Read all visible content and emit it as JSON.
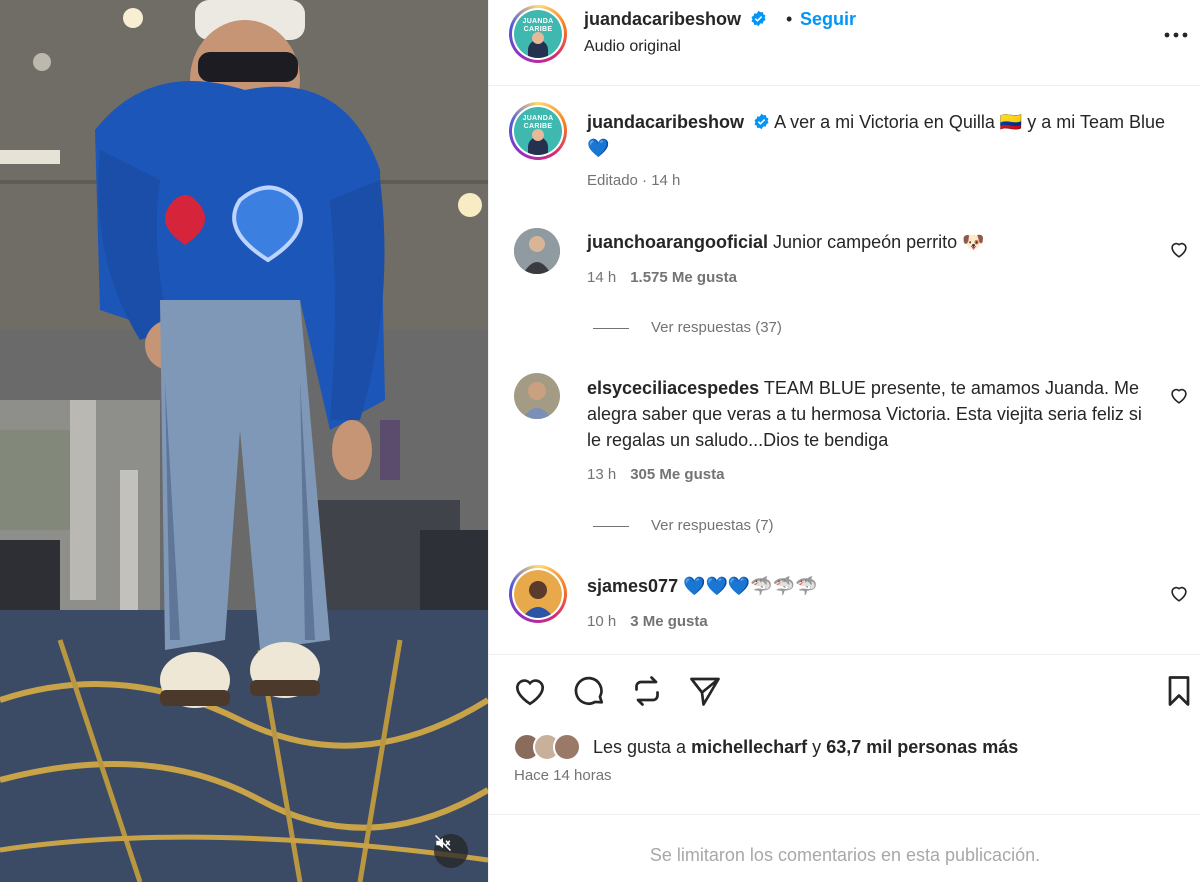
{
  "post": {
    "username": "juandacaribeshow",
    "follow_label": "Seguir",
    "dot": "•",
    "audio_label": "Audio original",
    "avatar_logo_text": "JUANDA CARIBE",
    "more_icon": "more-options-icon"
  },
  "caption": {
    "username": "juandacaribeshow",
    "text": "A ver a mi Victoria en Quilla 🇨🇴 y a mi Team Blue 💙",
    "meta": "Editado · 14 h"
  },
  "comments": [
    {
      "username": "juanchoarangooficial",
      "text": "Junior campeón perrito 🐶",
      "time": "14 h",
      "likes": "1.575 Me gusta",
      "replies": "Ver respuestas (37)"
    },
    {
      "username": "elsyceciliacespedes",
      "text": "TEAM BLUE presente, te amamos Juanda. Me alegra saber que veras a tu hermosa Victoria. Esta viejita seria feliz si le regalas un saludo...Dios te bendiga",
      "time": "13 h",
      "likes": "305 Me gusta",
      "replies": "Ver respuestas (7)"
    },
    {
      "username": "sjames077",
      "text": "💙💙💙🦈🦈🦈",
      "time": "10 h",
      "likes": "3 Me gusta"
    }
  ],
  "likes": {
    "prefix": "Les gusta a",
    "user": "michellecharf",
    "connector": "y",
    "others": "63,7 mil personas más"
  },
  "time_ago": "Hace 14 horas",
  "limited_notice": "Se limitaron los comentarios en esta publicación.",
  "colors": {
    "accent": "#0095f6",
    "verified": "#0095f6",
    "muted": "#737373"
  }
}
